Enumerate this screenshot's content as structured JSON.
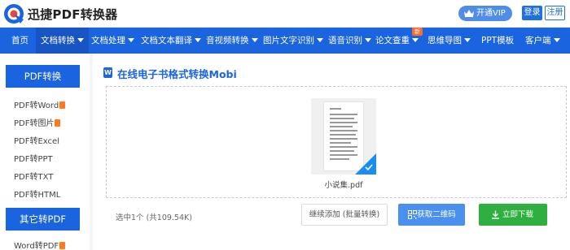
{
  "header": {
    "brand": "迅捷PDF转换器",
    "vip_label": "开通VIP",
    "login_label": "登录",
    "register_label": "注册"
  },
  "nav": {
    "items": [
      {
        "label": "首页",
        "dropdown": false
      },
      {
        "label": "文档转换",
        "dropdown": true,
        "active": true
      },
      {
        "label": "文档处理",
        "dropdown": true
      },
      {
        "label": "文档文本翻译",
        "dropdown": true
      },
      {
        "label": "音视频转换",
        "dropdown": true
      },
      {
        "label": "图片文字识别",
        "dropdown": true
      },
      {
        "label": "语音识别",
        "dropdown": true
      },
      {
        "label": "论文查重",
        "dropdown": true
      },
      {
        "label": "思维导图",
        "dropdown": true
      },
      {
        "label": "PPT模板",
        "dropdown": false
      },
      {
        "label": "客户端",
        "dropdown": true
      }
    ],
    "new_badge": "新"
  },
  "sidebar": {
    "group1_title": "PDF转换",
    "group1_items": [
      "PDF转Word",
      "PDF转图片",
      "PDF转Excel",
      "PDF转PPT",
      "PDF转TXT",
      "PDF转HTML"
    ],
    "group2_title": "其它转PDF",
    "group2_items": [
      "Word转PDF"
    ]
  },
  "main": {
    "title_icon": "W",
    "title": "在线电子书格式转换Mobi",
    "file_name": "小说集.pdf",
    "selection_info": "选中1个 (共109.54K)",
    "continue_label": "继续添加 (批量转换)",
    "qr_label": "获取二维码",
    "download_label": "立即下载"
  },
  "colors": {
    "primary": "#1b64e0",
    "download_green": "#2eaf3f",
    "qr_blue": "#4a90ee",
    "badge_orange": "#ff6a2a"
  },
  "icons": {
    "logo": "brand-logo-icon",
    "vip": "crown-icon",
    "check": "check-icon",
    "qr": "qr-code-icon",
    "download": "download-icon",
    "title": "word-doc-icon"
  }
}
